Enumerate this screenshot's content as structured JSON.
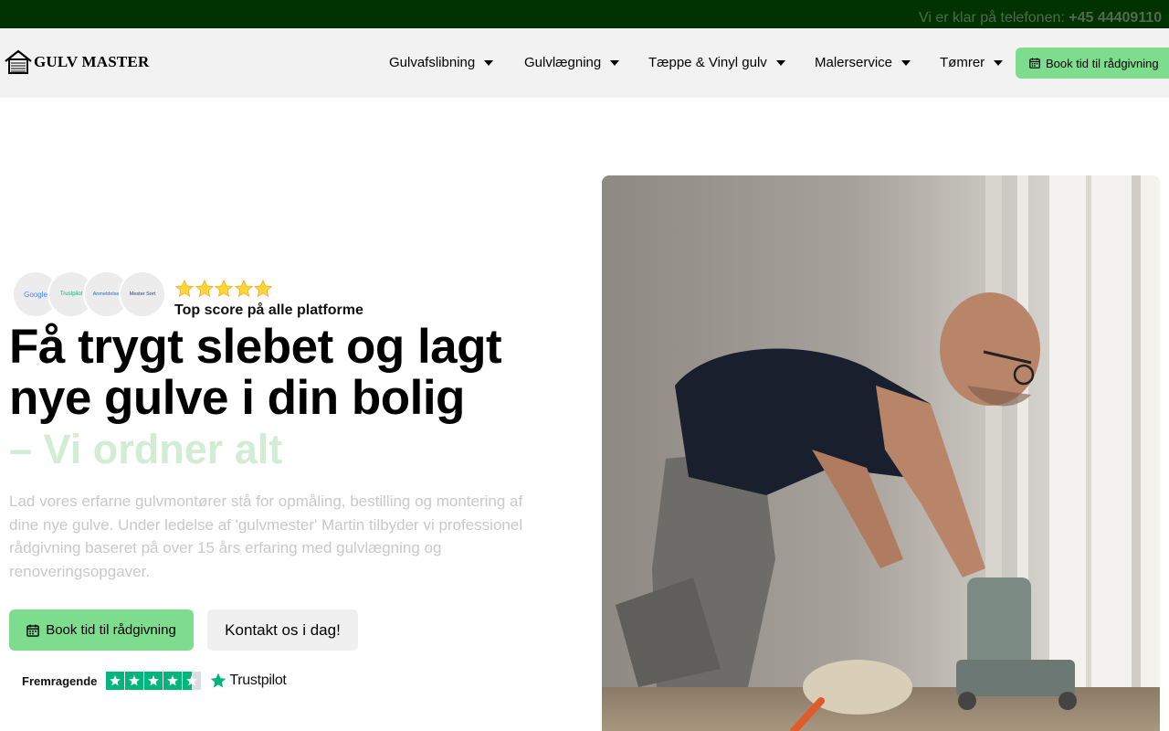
{
  "topbar": {
    "text": "Vi er klar på telefonen: ",
    "phone": "+45 44409110"
  },
  "header": {
    "logo_text": "GULV MASTER",
    "nav": [
      {
        "label": "Gulvafslibning"
      },
      {
        "label": "Gulvlægning"
      },
      {
        "label": "Tæppe & Vinyl gulv"
      },
      {
        "label": "Malerservice"
      },
      {
        "label": "Tømrer"
      }
    ],
    "cta_label": "Book tid til rådgivning"
  },
  "hero": {
    "badges": [
      "Google",
      "Trustpilot",
      "Anmeldelser",
      "Mester Sort"
    ],
    "stars": 5,
    "score_text": "Top score på alle platforme",
    "headline": "Få trygt slebet og lagt nye gulve i din bolig",
    "subheadline": "– Vi ordner alt",
    "description": "Lad vores erfarne gulvmontører stå for opmåling, bestilling og montering af dine nye gulve. Under ledelse af 'gulvmester' Martin tilbyder vi professionel rådgivning baseret på over 15 års erfaring med gulvlægning og renoveringsopgaver.",
    "primary_button": "Book tid til rådgivning",
    "secondary_button": "Kontakt os i dag!",
    "trustpilot": {
      "label": "Fremragende",
      "brand": "Trustpilot",
      "rating": 4.5
    }
  },
  "colors": {
    "topbar_bg": "#003300",
    "accent_green": "#7ddc8d",
    "header_bg": "#f2f2f2",
    "trustpilot_green": "#00b67a"
  }
}
